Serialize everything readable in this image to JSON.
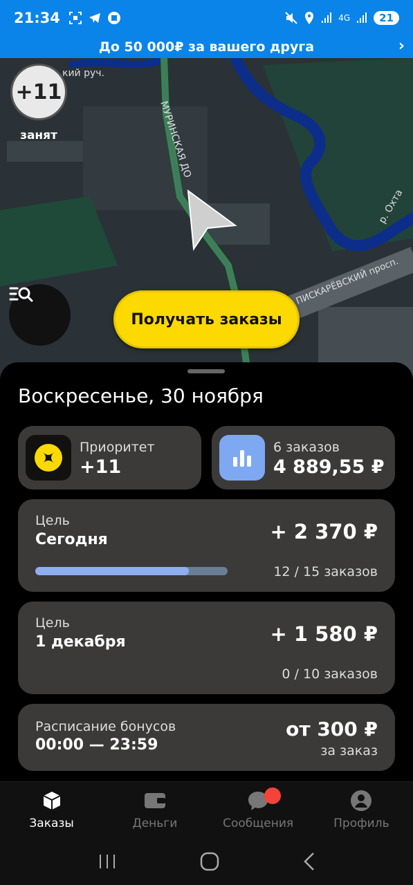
{
  "status_bar": {
    "time": "21:34",
    "network": "4G",
    "battery": "21"
  },
  "promo": {
    "text": "До 50 000₽ за вашего друга"
  },
  "map": {
    "busy_badge": "+11",
    "busy_label": "занят",
    "street_labels": [
      "МУРИНСКАЯ ДО",
      "ПИСКАРЁВСКИЙ просп.",
      "р. Охта",
      "кий руч."
    ],
    "get_orders_label": "Получать заказы"
  },
  "sheet": {
    "date": "Воскресенье, 30 ноября",
    "priority": {
      "label": "Приоритет",
      "value": "+11"
    },
    "orders": {
      "label": "6 заказов",
      "value": "4 889,55 ₽"
    },
    "goals": [
      {
        "label": "Цель",
        "title": "Сегодня",
        "amount": "+ 2 370 ₽",
        "count": "12 / 15 заказов",
        "progress": 0.8,
        "show_bar": true
      },
      {
        "label": "Цель",
        "title": "1 декабря",
        "amount": "+ 1 580 ₽",
        "count": "0 / 10 заказов",
        "progress": 0.0,
        "show_bar": false
      }
    ],
    "bonus": {
      "label": "Расписание бонусов",
      "time": "00:00 — 23:59",
      "amount": "от 300 ₽",
      "sub": "за заказ"
    }
  },
  "nav": {
    "items": [
      {
        "label": "Заказы",
        "icon": "box-icon",
        "active": true
      },
      {
        "label": "Деньги",
        "icon": "wallet-icon",
        "active": false
      },
      {
        "label": "Сообщения",
        "icon": "chat-icon",
        "active": false
      },
      {
        "label": "Профиль",
        "icon": "person-icon",
        "active": false
      }
    ]
  },
  "colors": {
    "status_bar": "#0a84e8",
    "accent_yellow": "#fcd900",
    "card_bg": "#3b3a39",
    "progress_fill": "#8faeef",
    "notification_dot": "#f4433a"
  }
}
